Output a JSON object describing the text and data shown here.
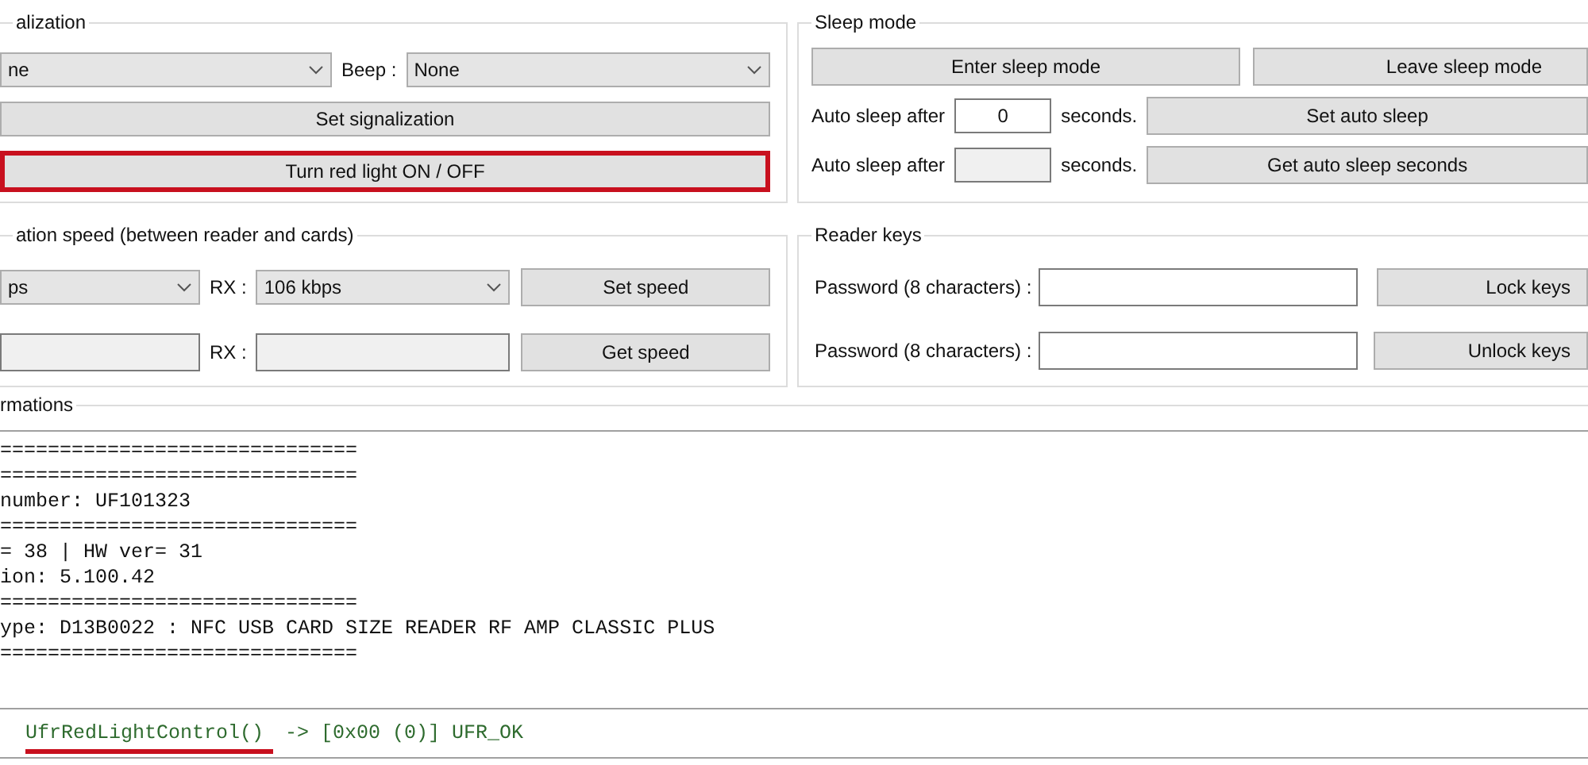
{
  "signalization": {
    "title": "alization",
    "light_select": {
      "value": "ne"
    },
    "beep_label": "Beep :",
    "beep_select": {
      "value": "None"
    },
    "buttons": [
      {
        "label": "Set signalization",
        "highlighted": false
      },
      {
        "label": "Turn red light ON / OFF",
        "highlighted": true
      }
    ]
  },
  "sleep_mode": {
    "title": "Sleep mode",
    "buttons": [
      "Enter sleep mode",
      "Leave sleep mode"
    ],
    "rows": [
      {
        "label": "Auto sleep after",
        "value": "0",
        "editable": true,
        "unit": "seconds.",
        "button": "Set auto sleep"
      },
      {
        "label": "Auto sleep after",
        "value": "",
        "editable": false,
        "unit": "seconds.",
        "button": "Get auto sleep seconds"
      }
    ]
  },
  "speed": {
    "title": "ation speed (between reader and cards)",
    "rows": [
      {
        "kind": "select",
        "tx": "ps",
        "rx_label": "RX :",
        "rx": "106 kbps",
        "button": "Set speed"
      },
      {
        "kind": "readonly",
        "tx": "",
        "rx_label": "RX :",
        "rx": "",
        "button": "Get speed"
      }
    ]
  },
  "reader_keys": {
    "title": "Reader keys",
    "rows": [
      {
        "label": "Password (8 characters) :",
        "button": "Lock keys"
      },
      {
        "label": "Password (8 characters) :",
        "button": "Unlock keys"
      }
    ]
  },
  "informations": {
    "title": "rmations",
    "log": [
      "==============================",
      "==============================",
      "number: UF101323",
      "==============================",
      "= 38 | HW ver= 31",
      "ion: 5.100.42",
      "==============================",
      "ype: D13B0022 : NFC USB CARD SIZE READER RF AMP CLASSIC PLUS",
      "=============================="
    ]
  },
  "status": {
    "function": "UfrRedLightControl()",
    "result": " -> [0x00 (0)] UFR_OK",
    "underlined": true
  }
}
